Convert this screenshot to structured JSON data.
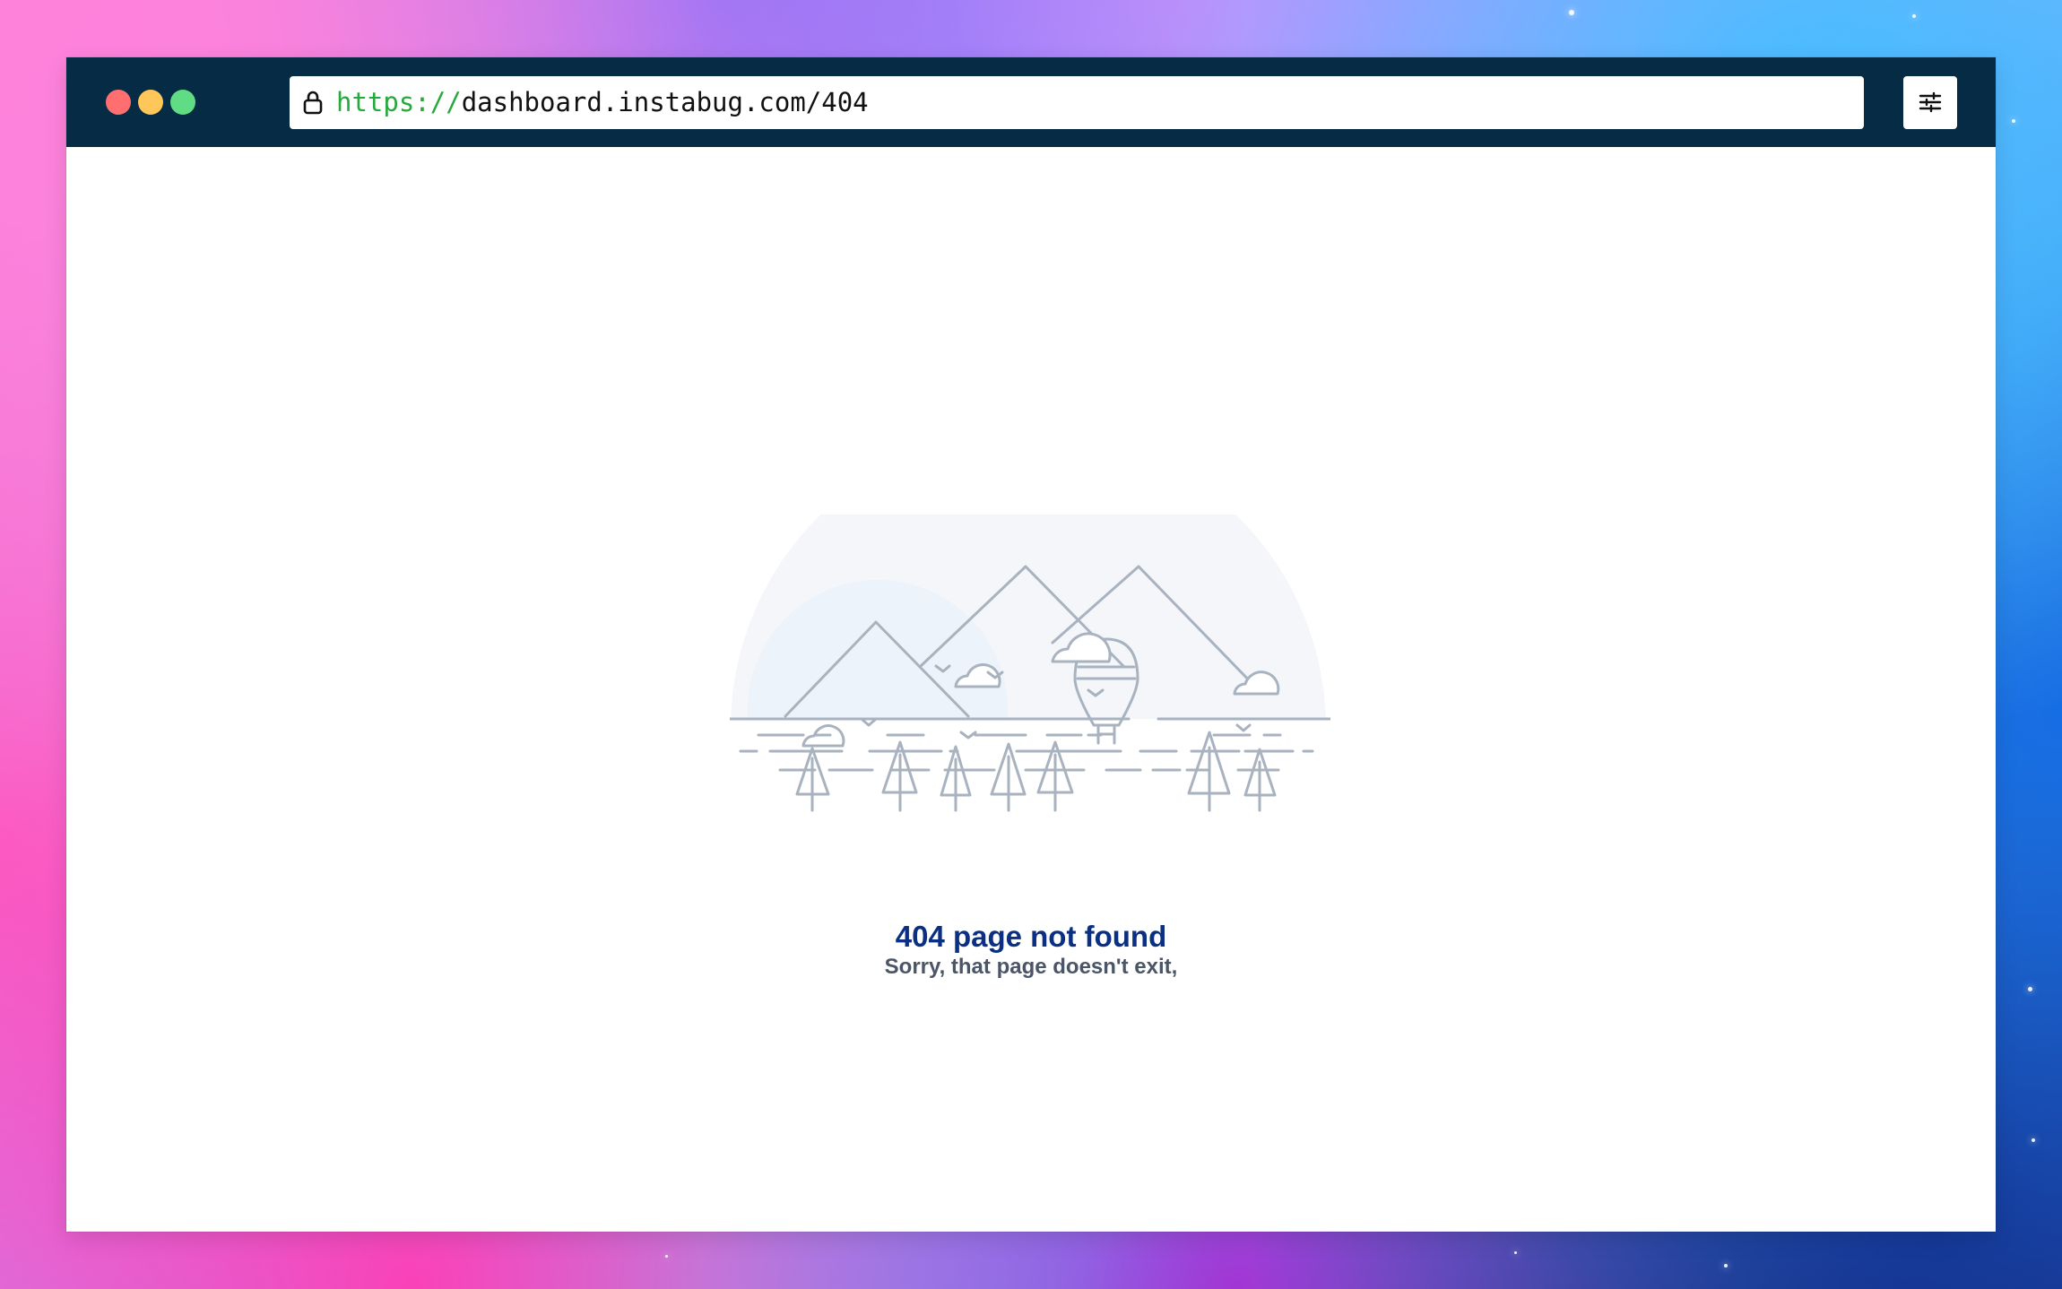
{
  "browser": {
    "window_controls": [
      "close",
      "minimize",
      "maximize"
    ],
    "address_bar": {
      "protocol": "https://",
      "host_path": "dashboard.instabug.com/404",
      "lock_icon": "lock-icon"
    },
    "settings_icon": "sliders-icon"
  },
  "page": {
    "title": "404 page not found",
    "subtitle": "Sorry, that page doesn't exit,"
  },
  "colors": {
    "browser_bar": "#062b45",
    "close_dot": "#ff6f6f",
    "minimize_dot": "#ffc65a",
    "maximize_dot": "#5fdc84",
    "url_protocol": "#26a93d",
    "title": "#0a2f83",
    "subtitle": "#4a5568",
    "illustration_stroke": "#a9b3c0"
  }
}
